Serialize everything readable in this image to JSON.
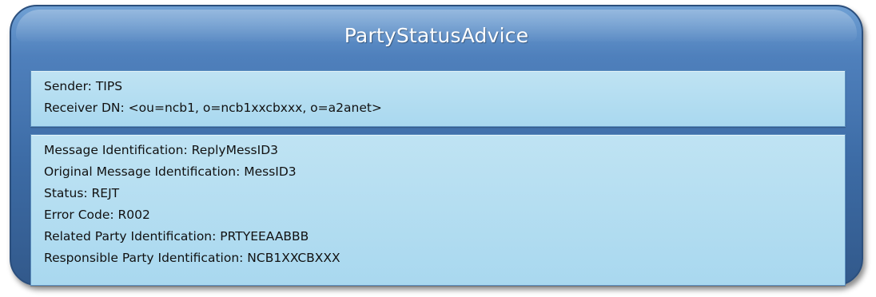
{
  "title": "PartyStatusAdvice",
  "header": {
    "sender": "Sender: TIPS",
    "receiver": "Receiver DN: <ou=ncb1, o=ncb1xxcbxxx, o=a2anet>"
  },
  "body": {
    "lines": [
      "Message Identification: ReplyMessID3",
      "Original Message Identification: MessID3",
      "Status: REJT",
      "Error Code: R002",
      "Related Party Identification: PRTYEEAABBB",
      "Responsible Party Identification: NCB1XXCBXXX"
    ]
  },
  "colors": {
    "frame": "#3d6ca6",
    "panel": "#b3ddf1",
    "title_text": "#ffffff"
  }
}
